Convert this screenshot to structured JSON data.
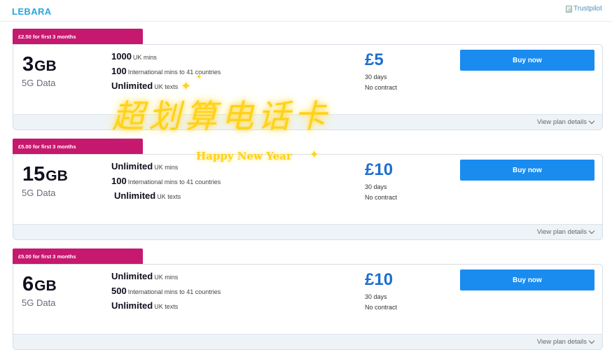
{
  "header": {
    "logo_text": "LEBARA",
    "trustpilot_alt": "Trustpilot"
  },
  "plans": [
    {
      "promo": "£2.50 for first 3 months",
      "data_amount": "3",
      "data_unit": "GB",
      "data_label": "5G Data",
      "features": [
        {
          "value": "1000",
          "label": "UK mins"
        },
        {
          "value": "100",
          "label": "International mins to 41 countries"
        },
        {
          "value": "Unlimited",
          "label": "UK texts"
        }
      ],
      "price": "£5",
      "duration": "30 days",
      "contract": "No contract",
      "buy_label": "Buy now",
      "details_label": "View plan details"
    },
    {
      "promo": "£5.00 for first 3 months",
      "data_amount": "15",
      "data_unit": "GB",
      "data_label": "5G Data",
      "features": [
        {
          "value": "Unlimited",
          "label": "UK mins"
        },
        {
          "value": "100",
          "label": "International mins to 41 countries"
        },
        {
          "value": "Unlimited",
          "label": "UK texts"
        }
      ],
      "price": "£10",
      "duration": "30 days",
      "contract": "No contract",
      "buy_label": "Buy now",
      "details_label": "View plan details"
    },
    {
      "promo": "£5.00 for first 3 months",
      "data_amount": "6",
      "data_unit": "GB",
      "data_label": "5G Data",
      "features": [
        {
          "value": "Unlimited",
          "label": "UK mins"
        },
        {
          "value": "500",
          "label": "International mins to 41 countries"
        },
        {
          "value": "Unlimited",
          "label": "UK texts"
        }
      ],
      "price": "£10",
      "duration": "30 days",
      "contract": "No contract",
      "buy_label": "Buy now",
      "details_label": "View plan details"
    }
  ],
  "overlay": {
    "chinese_text": "超划算电话卡",
    "english_text": "Happy New Year",
    "color": "#ffd21a"
  },
  "colors": {
    "brand": "#2aa3e0",
    "promo": "#c6186e",
    "price": "#1e6fcf",
    "button": "#1a8cf0"
  }
}
